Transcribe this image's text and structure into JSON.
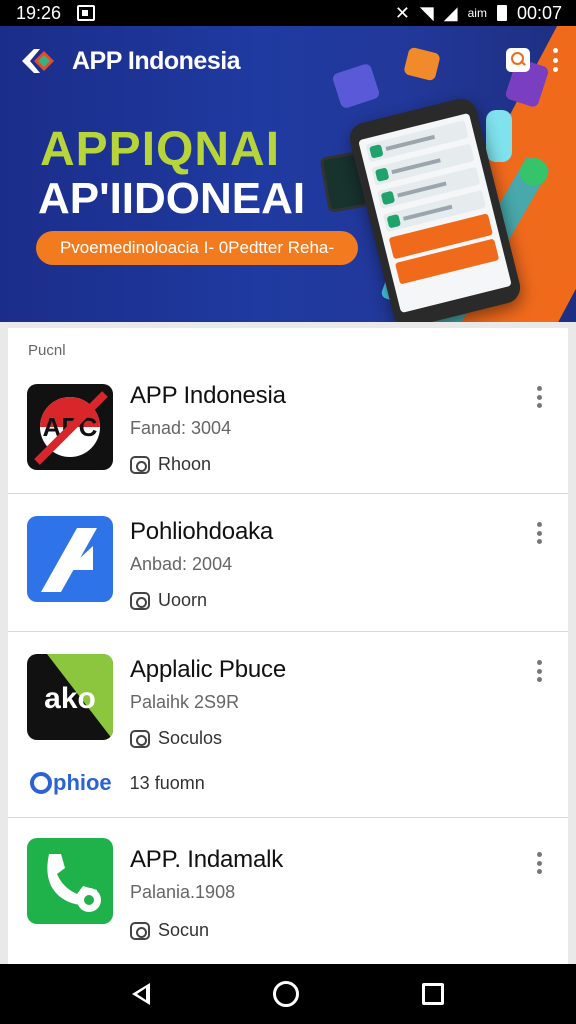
{
  "status_bar": {
    "time_left": "19:26",
    "network_label": "aim",
    "time_right": "00:07"
  },
  "banner": {
    "app_title": "APP Indonesia",
    "headline_1": "APPIQNAI",
    "headline_2": "AP'IIDONEAI",
    "pill_text": "Pvoemedinoloacia I- 0Pedtter Reha-"
  },
  "list": {
    "section_label": "Pucnl",
    "items": [
      {
        "title": "APP Indonesia",
        "subtitle": "Fanad: 3004",
        "meta": "Rhoon",
        "icon": "app-logo-red-icon"
      },
      {
        "title": "Pohliohdoaka",
        "subtitle": "Anbad: 2004",
        "meta": "Uoorn",
        "icon": "blue-a-logo-icon"
      },
      {
        "title": "Applalic Pbuce",
        "subtitle": "Palaihk 2S9R",
        "meta": "Soculos",
        "icon": "green-ako-logo-icon",
        "extra_brand": "phioe",
        "extra_text": "13 fuomn"
      },
      {
        "title": "APP. Indamalk",
        "subtitle": "Palania.1908",
        "meta": "Socun",
        "icon": "phone-gear-logo-icon"
      }
    ]
  },
  "colors": {
    "banner_blue": "#1f3aa0",
    "accent_orange": "#f06a1c",
    "headline_green": "#b7d43a"
  }
}
